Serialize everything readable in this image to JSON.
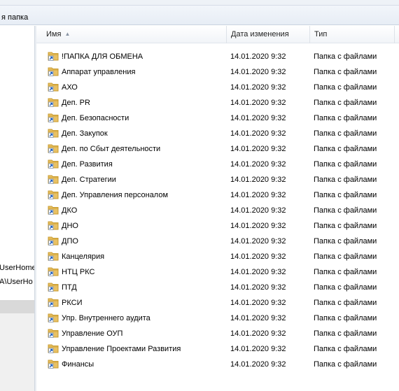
{
  "toolbar": {
    "new_folder_label": "я папка"
  },
  "nav_pane": {
    "items": [
      {
        "label": "\\UserHome"
      },
      {
        "label": ".A\\UserHo"
      }
    ]
  },
  "columns": {
    "name": "Имя",
    "date": "Дата изменения",
    "type": "Тип"
  },
  "colors": {
    "folder": "#e8c165",
    "folder_dark": "#c89a2c",
    "shortcut_arrow": "#1f5fbf",
    "selected_nav": "#d9d9d9"
  },
  "files": [
    {
      "name": "!ПАПКА ДЛЯ ОБМЕНА",
      "date": "14.01.2020 9:32",
      "type": "Папка с файлами"
    },
    {
      "name": "Аппарат управления",
      "date": "14.01.2020 9:32",
      "type": "Папка с файлами"
    },
    {
      "name": "АХО",
      "date": "14.01.2020 9:32",
      "type": "Папка с файлами"
    },
    {
      "name": "Деп. PR",
      "date": "14.01.2020 9:32",
      "type": "Папка с файлами"
    },
    {
      "name": "Деп. Безопасности",
      "date": "14.01.2020 9:32",
      "type": "Папка с файлами"
    },
    {
      "name": "Деп. Закупок",
      "date": "14.01.2020 9:32",
      "type": "Папка с файлами"
    },
    {
      "name": "Деп. по Сбыт деятельности",
      "date": "14.01.2020 9:32",
      "type": "Папка с файлами"
    },
    {
      "name": "Деп. Развития",
      "date": "14.01.2020 9:32",
      "type": "Папка с файлами"
    },
    {
      "name": "Деп. Стратегии",
      "date": "14.01.2020 9:32",
      "type": "Папка с файлами"
    },
    {
      "name": "Деп. Управления персоналом",
      "date": "14.01.2020 9:32",
      "type": "Папка с файлами"
    },
    {
      "name": "ДКО",
      "date": "14.01.2020 9:32",
      "type": "Папка с файлами"
    },
    {
      "name": "ДНО",
      "date": "14.01.2020 9:32",
      "type": "Папка с файлами"
    },
    {
      "name": "ДПО",
      "date": "14.01.2020 9:32",
      "type": "Папка с файлами"
    },
    {
      "name": "Канцелярия",
      "date": "14.01.2020 9:32",
      "type": "Папка с файлами"
    },
    {
      "name": "НТЦ РКС",
      "date": "14.01.2020 9:32",
      "type": "Папка с файлами"
    },
    {
      "name": "ПТД",
      "date": "14.01.2020 9:32",
      "type": "Папка с файлами"
    },
    {
      "name": "РКСИ",
      "date": "14.01.2020 9:32",
      "type": "Папка с файлами"
    },
    {
      "name": "Упр. Внутреннего аудита",
      "date": "14.01.2020 9:32",
      "type": "Папка с файлами"
    },
    {
      "name": "Управление ОУП",
      "date": "14.01.2020 9:32",
      "type": "Папка с файлами"
    },
    {
      "name": "Управление Проектами Развития",
      "date": "14.01.2020 9:32",
      "type": "Папка с файлами"
    },
    {
      "name": "Финансы",
      "date": "14.01.2020 9:32",
      "type": "Папка с файлами"
    }
  ]
}
